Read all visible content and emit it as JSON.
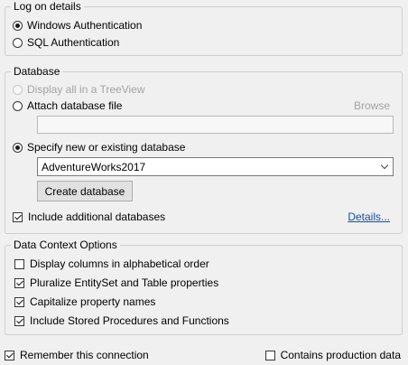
{
  "logon": {
    "title": "Log on details",
    "windows_auth": "Windows Authentication",
    "sql_auth": "SQL Authentication"
  },
  "database": {
    "title": "Database",
    "treeview": "Display all in a TreeView",
    "attach": "Attach database file",
    "browse": "Browse",
    "attach_path": "",
    "specify": "Specify new or existing database",
    "selected_db": "AdventureWorks2017",
    "create_button": "Create database",
    "include_additional": "Include additional databases",
    "details_link": "Details..."
  },
  "context_options": {
    "title": "Data Context Options",
    "alphabetical": "Display columns in alphabetical order",
    "pluralize": "Pluralize EntitySet and Table properties",
    "capitalize": "Capitalize property names",
    "stored_procs": "Include Stored Procedures and Functions"
  },
  "footer": {
    "remember": "Remember this connection",
    "production": "Contains production data"
  }
}
